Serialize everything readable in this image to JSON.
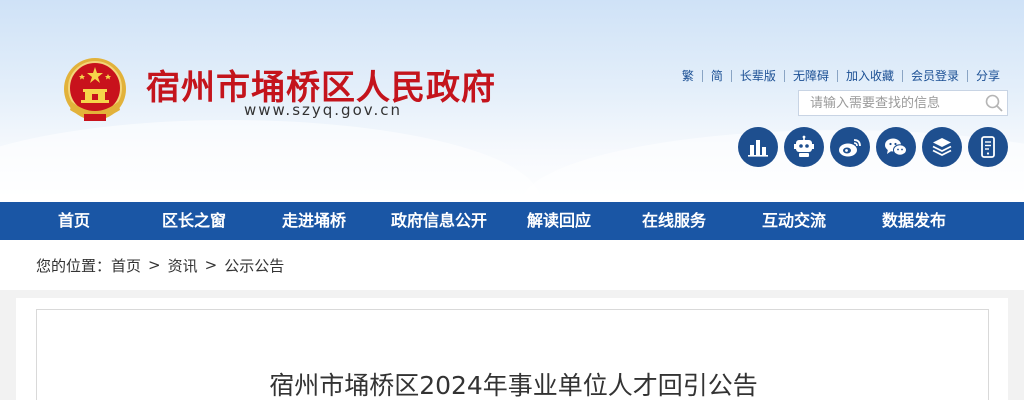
{
  "header": {
    "site_title": "宿州市埇桥区人民政府",
    "domain": "www.szyq.gov.cn",
    "top_links": [
      "繁",
      "简",
      "长辈版",
      "无障碍",
      "加入收藏",
      "会员登录",
      "分享"
    ],
    "search": {
      "placeholder": "请输入需要查找的信息"
    },
    "icon_buttons": [
      "chart-icon",
      "robot-icon",
      "weibo-icon",
      "wechat-icon",
      "layers-icon",
      "mobile-icon"
    ]
  },
  "nav": {
    "items": [
      "首页",
      "区长之窗",
      "走进埇桥",
      "政府信息公开",
      "解读回应",
      "在线服务",
      "互动交流",
      "数据发布"
    ]
  },
  "breadcrumb": {
    "prefix": "您的位置：",
    "items": [
      "首页",
      "资讯",
      "公示公告"
    ],
    "separator": ">"
  },
  "article": {
    "title": "宿州市埇桥区2024年事业单位人才回引公告"
  },
  "colors": {
    "title_red": "#c4141c",
    "nav_blue": "#1a56a5",
    "icon_blue": "#1e4f8f",
    "link_blue": "#1b4f94"
  }
}
